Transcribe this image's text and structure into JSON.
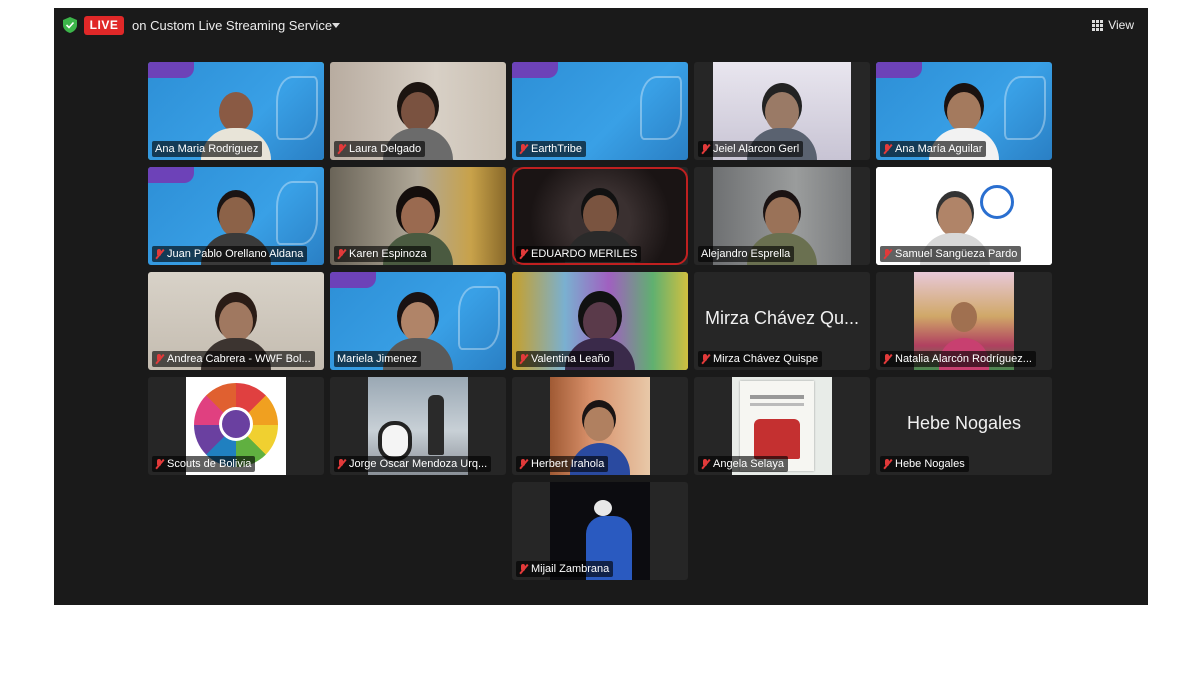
{
  "topbar": {
    "live_label": "LIVE",
    "stream_label": "on Custom Live Streaming Service",
    "view_label": "View",
    "colors": {
      "live": "#e02828",
      "shield": "#3cb54a",
      "active_speaker": "#5cd65c"
    }
  },
  "participants": [
    {
      "name": "Ana Maria Rodriguez",
      "muted": false,
      "active": true,
      "video": "scout-bg"
    },
    {
      "name": "Laura Delgado",
      "muted": true,
      "video": "camera"
    },
    {
      "name": "EarthTribe",
      "muted": true,
      "video": "scout-bg"
    },
    {
      "name": "Jeiel Alarcon Gerl",
      "muted": true,
      "video": "camera"
    },
    {
      "name": "Ana María Aguilar",
      "muted": true,
      "video": "scout-bg"
    },
    {
      "name": "Juan Pablo Orellano Aldana",
      "muted": true,
      "video": "scout-bg"
    },
    {
      "name": "Karen Espinoza",
      "muted": true,
      "video": "camera"
    },
    {
      "name": "EDUARDO  MERILES",
      "muted": true,
      "video": "camera"
    },
    {
      "name": "Alejandro Esprella",
      "muted": false,
      "video": "camera"
    },
    {
      "name": "Samuel Sangüeza Pardo",
      "muted": true,
      "video": "camera"
    },
    {
      "name": "Andrea Cabrera - WWF Bol...",
      "muted": true,
      "video": "camera"
    },
    {
      "name": "Mariela Jimenez",
      "muted": false,
      "video": "scout-bg"
    },
    {
      "name": "Valentina Leaño",
      "muted": true,
      "video": "camera"
    },
    {
      "name": "Mirza Chávez Quispe",
      "muted": true,
      "video": "none",
      "display_name": "Mirza Chávez Qu..."
    },
    {
      "name": "Natalia Alarcón Rodríguez...",
      "muted": true,
      "video": "camera"
    },
    {
      "name": "Scouts de Bolivia",
      "muted": true,
      "video": "logo"
    },
    {
      "name": "Jorge Oscar Mendoza Urq...",
      "muted": true,
      "video": "camera"
    },
    {
      "name": "Herbert Irahola",
      "muted": true,
      "video": "camera"
    },
    {
      "name": "Angela Selaya",
      "muted": true,
      "video": "camera"
    },
    {
      "name": "Hebe Nogales",
      "muted": true,
      "video": "none",
      "display_name": "Hebe Nogales"
    },
    {
      "name": "Mijail Zambrana",
      "muted": true,
      "video": "camera"
    }
  ]
}
